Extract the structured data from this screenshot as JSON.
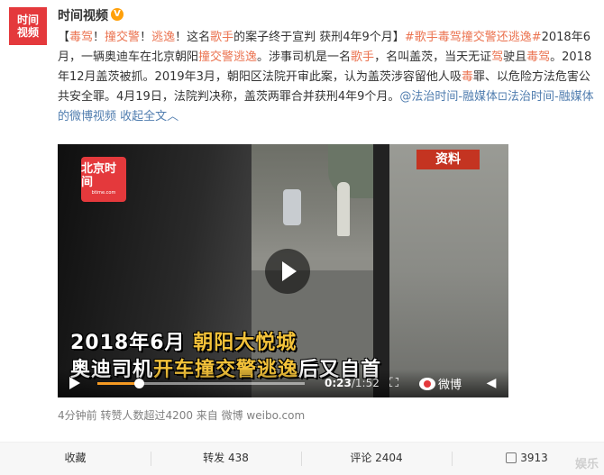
{
  "post": {
    "author": "时间视频",
    "verified_badge": "V",
    "avatar_text": [
      "时间",
      "视频"
    ],
    "text_segments": [
      {
        "t": "【",
        "c": ""
      },
      {
        "t": "毒驾",
        "c": "lnk"
      },
      {
        "t": "！",
        "c": ""
      },
      {
        "t": "撞交警",
        "c": "lnk"
      },
      {
        "t": "！",
        "c": ""
      },
      {
        "t": "逃逸",
        "c": "lnk"
      },
      {
        "t": "！这名",
        "c": ""
      },
      {
        "t": "歌手",
        "c": "lnk"
      },
      {
        "t": "的案子终于宣判 获刑4年9个月】",
        "c": ""
      },
      {
        "t": "#歌手毒驾撞交警还逃逸#",
        "c": "lnk"
      },
      {
        "t": "2018年6月，一辆奥迪车在北京朝阳",
        "c": ""
      },
      {
        "t": "撞交警逃逸",
        "c": "lnk"
      },
      {
        "t": "。涉事司机是一名",
        "c": ""
      },
      {
        "t": "歌手",
        "c": "lnk"
      },
      {
        "t": "，名叫盖茨，当天无证",
        "c": ""
      },
      {
        "t": "驾",
        "c": "lnk"
      },
      {
        "t": "驶且",
        "c": ""
      },
      {
        "t": "毒驾",
        "c": "lnk"
      },
      {
        "t": "。2018年12月盖茨被抓。2019年3月，朝阳区法院开审此案，认为盖茨涉容留他人吸",
        "c": ""
      },
      {
        "t": "毒",
        "c": "lnk"
      },
      {
        "t": "罪、以危险方法危害公共安全罪。4月19日，法院判决称，盖茨两罪合并获刑4年9个月。",
        "c": ""
      },
      {
        "t": "@法治时间-融媒体",
        "c": "blue"
      },
      {
        "t": "⊡法治时间-融媒体的微博视频",
        "c": "blue"
      },
      {
        "t": " 收起全文",
        "c": "blue"
      },
      {
        "t": "︿",
        "c": "blue"
      }
    ],
    "meta": "4分钟前 转赞人数超过4200 来自 微博 weibo.com"
  },
  "video": {
    "logo_title": "北京时间",
    "logo_sub": "btime.com",
    "tag": "资料",
    "caption_line1_a": "2018年6月",
    "caption_line1_b": "朝阳大悦城",
    "caption_line2_a": "奥迪司机",
    "caption_line2_b": "开车撞交警逃逸",
    "caption_line2_c": "后又自首",
    "current_time": "0:23",
    "duration": "/1:52",
    "progress": 0.2,
    "weibo_label": "微博",
    "icons": [
      "play-icon",
      "play-small-icon",
      "fullscreen-icon",
      "volume-icon"
    ]
  },
  "footer": {
    "collect": "收藏",
    "forward": "转发 438",
    "comment": "评论 2404",
    "like": "3913",
    "watermark": "娱乐"
  },
  "colors": {
    "link": "#eb7350",
    "blue": "#507daf",
    "brand_red": "#e4393c",
    "progress": "#f59a23"
  }
}
